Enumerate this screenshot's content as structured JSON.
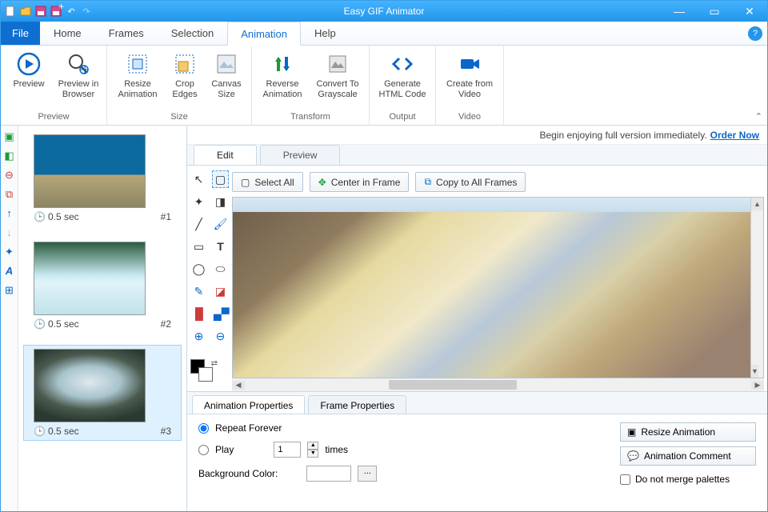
{
  "app_title": "Easy GIF Animator",
  "menu": {
    "file": "File",
    "tabs": [
      "Home",
      "Frames",
      "Selection",
      "Animation",
      "Help"
    ],
    "active": 3
  },
  "ribbon": {
    "groups": [
      {
        "title": "Preview",
        "buttons": [
          {
            "label": "Preview",
            "icon": "play"
          },
          {
            "label": "Preview in Browser",
            "icon": "browser"
          }
        ]
      },
      {
        "title": "Size",
        "buttons": [
          {
            "label": "Resize Animation",
            "icon": "resize"
          },
          {
            "label": "Crop Edges",
            "icon": "crop"
          },
          {
            "label": "Canvas Size",
            "icon": "canvas"
          }
        ]
      },
      {
        "title": "Transform",
        "buttons": [
          {
            "label": "Reverse Animation",
            "icon": "reverse"
          },
          {
            "label": "Convert To Grayscale",
            "icon": "grayscale"
          }
        ]
      },
      {
        "title": "Output",
        "buttons": [
          {
            "label": "Generate HTML Code",
            "icon": "htmlcode"
          }
        ]
      },
      {
        "title": "Video",
        "buttons": [
          {
            "label": "Create from Video",
            "icon": "video"
          }
        ]
      }
    ]
  },
  "frames": [
    {
      "time": "0.5 sec",
      "num": "#1"
    },
    {
      "time": "0.5 sec",
      "num": "#2"
    },
    {
      "time": "0.5 sec",
      "num": "#3"
    }
  ],
  "promo": {
    "text": "Begin enjoying full version immediately.",
    "link": "Order Now"
  },
  "editor_tabs": {
    "edit": "Edit",
    "preview": "Preview"
  },
  "ebuttons": {
    "select_all": "Select All",
    "center": "Center in Frame",
    "copy": "Copy to All Frames"
  },
  "props": {
    "tabs": {
      "anim": "Animation Properties",
      "frame": "Frame Properties"
    },
    "repeat": "Repeat Forever",
    "play": "Play",
    "times": "times",
    "play_count": "1",
    "bgcolor_label": "Background Color:",
    "resize_btn": "Resize Animation",
    "comment_btn": "Animation Comment",
    "nomerge": "Do not merge palettes"
  }
}
